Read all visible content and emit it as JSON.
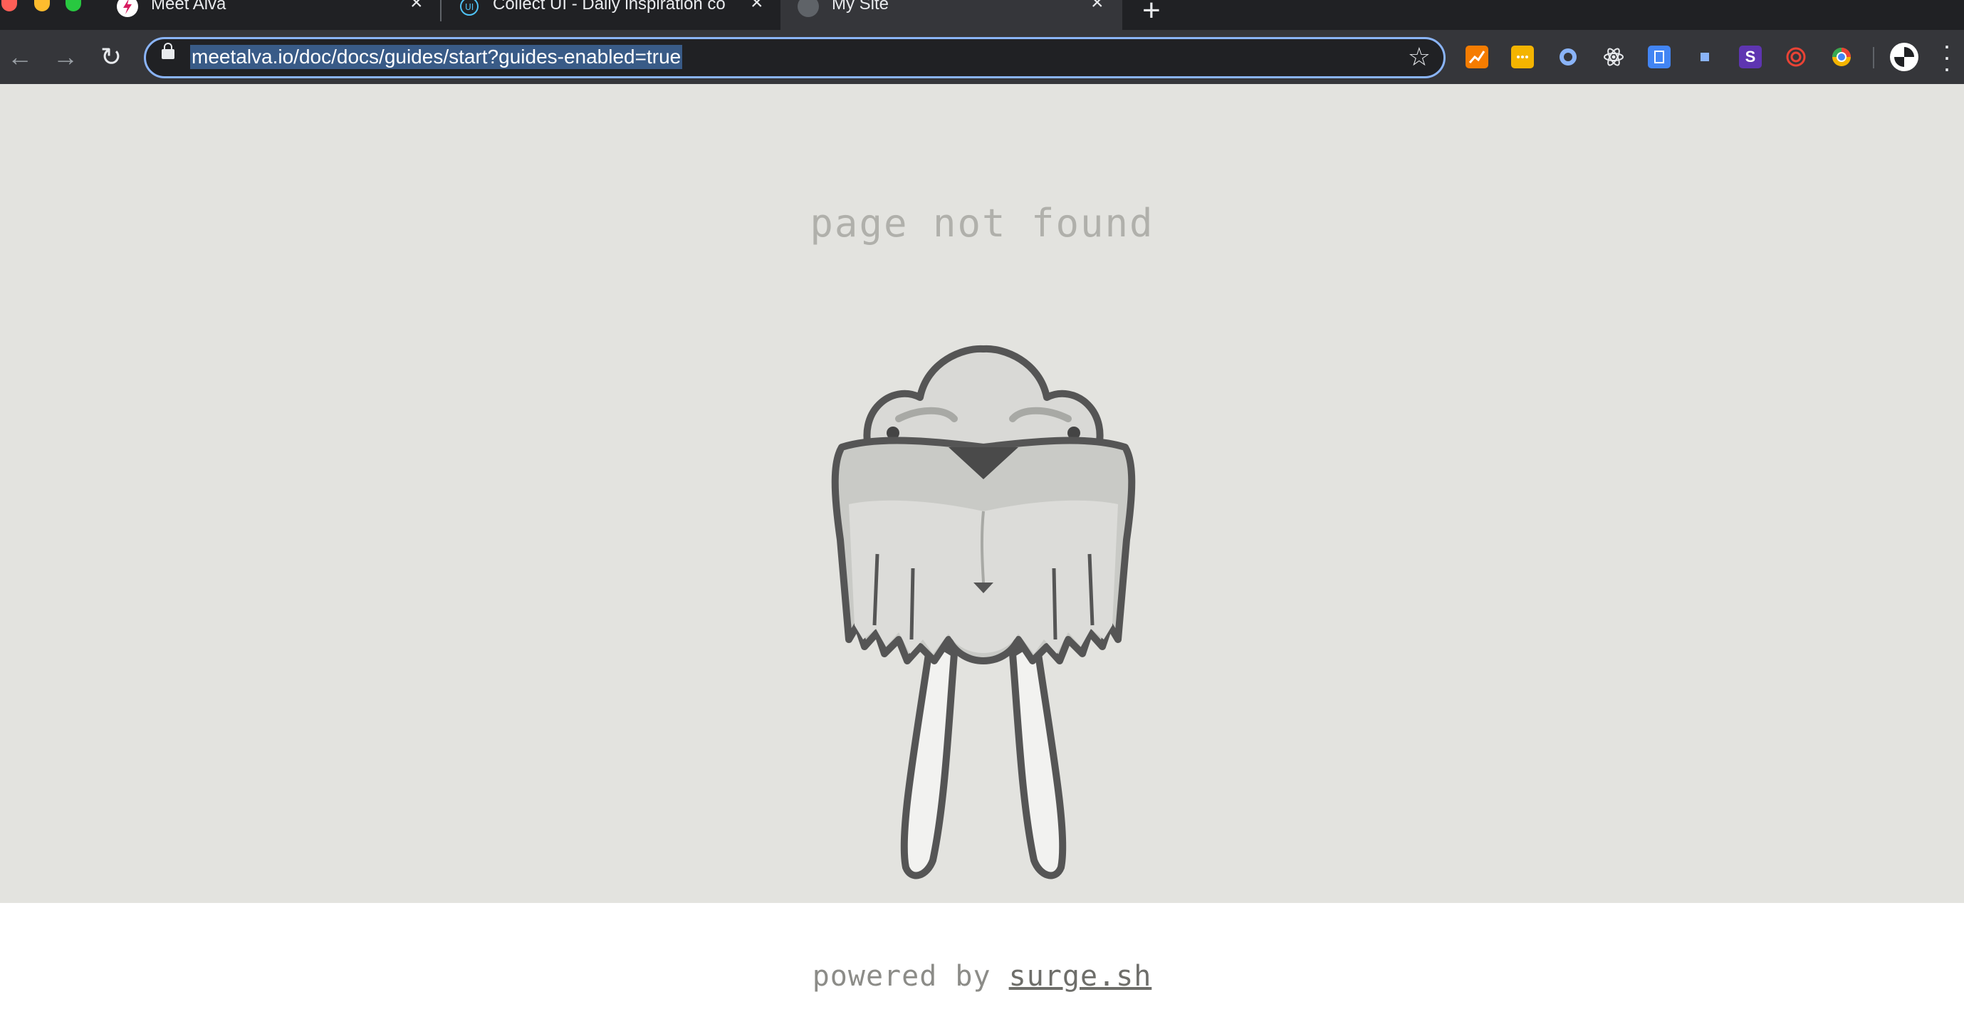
{
  "browser": {
    "tabs": [
      {
        "title": "Meet Alva",
        "active": false,
        "favicon": "alva-bolt-icon",
        "color": "#ffffff"
      },
      {
        "title": "Collect UI - Daily inspiration co",
        "active": false,
        "favicon": "collectui-icon",
        "color": "#4fc3f7"
      },
      {
        "title": "My Site",
        "active": true,
        "favicon": "globe-icon",
        "color": "#5f6368"
      }
    ],
    "new_tab": "+",
    "url": "meetalva.io/doc/docs/guides/start?guides-enabled=true",
    "extensions": [
      {
        "name": "analytics-extension-icon",
        "color": "#f57c00"
      },
      {
        "name": "notes-extension-icon",
        "color": "#f4b400"
      },
      {
        "name": "circle-extension-icon",
        "color": "#8ab4f8"
      },
      {
        "name": "react-devtools-icon",
        "color": "#61dafb"
      },
      {
        "name": "bootstrap-extension-icon",
        "color": "#4285f4"
      },
      {
        "name": "square-extension-icon",
        "color": "#4285f4"
      },
      {
        "name": "stylus-extension-icon",
        "color": "#7b1fa2",
        "label": "S"
      },
      {
        "name": "spiral-extension-icon",
        "color": "#ea4335"
      },
      {
        "name": "chrome-color-extension-icon",
        "color": "#34a853"
      }
    ]
  },
  "page": {
    "heading": "page not found",
    "footer_prefix": "powered by ",
    "footer_link": "surge.sh",
    "background": "#e3e3df"
  }
}
